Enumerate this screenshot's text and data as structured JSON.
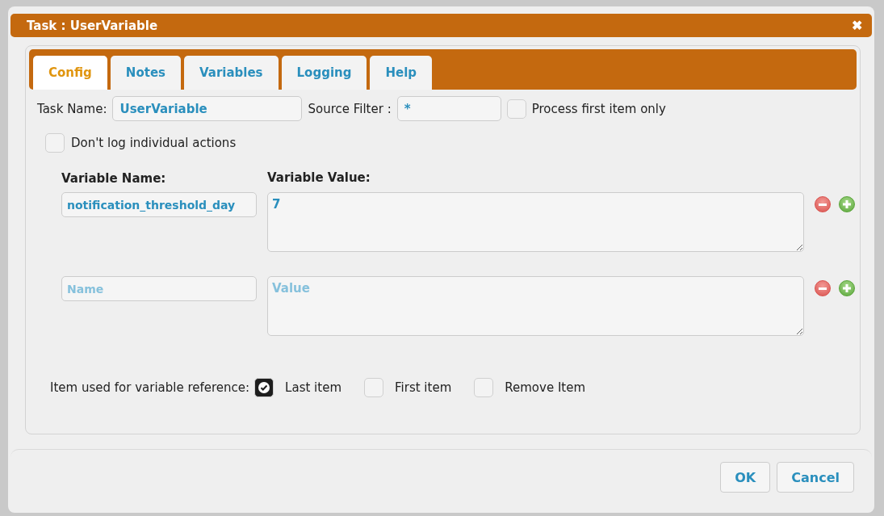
{
  "window": {
    "title": "Task : UserVariable",
    "close": "✖"
  },
  "tabs": [
    {
      "label": "Config",
      "selected": true
    },
    {
      "label": "Notes",
      "selected": false
    },
    {
      "label": "Variables",
      "selected": false
    },
    {
      "label": "Logging",
      "selected": false
    },
    {
      "label": "Help",
      "selected": false
    }
  ],
  "task_name": {
    "label": "Task Name:",
    "value": "UserVariable"
  },
  "source_filter": {
    "label": "Source Filter :",
    "value": "*"
  },
  "process_first_item_only": {
    "label": "Process first item only",
    "checked": false
  },
  "dont_log_individual_actions": {
    "label": "Don't log individual actions",
    "checked": false
  },
  "variables": {
    "name_heading": "Variable Name:",
    "value_heading": "Variable Value:",
    "rows": [
      {
        "name": "notification_threshold_day",
        "value": "7"
      },
      {
        "name_placeholder": "Name",
        "value_placeholder": "Value"
      }
    ]
  },
  "reference": {
    "label": "Item used for variable reference:",
    "options": [
      {
        "label": "Last item",
        "checked": true
      },
      {
        "label": "First item",
        "checked": false
      },
      {
        "label": "Remove Item",
        "checked": false
      }
    ]
  },
  "buttons": [
    "OK",
    "Cancel"
  ]
}
